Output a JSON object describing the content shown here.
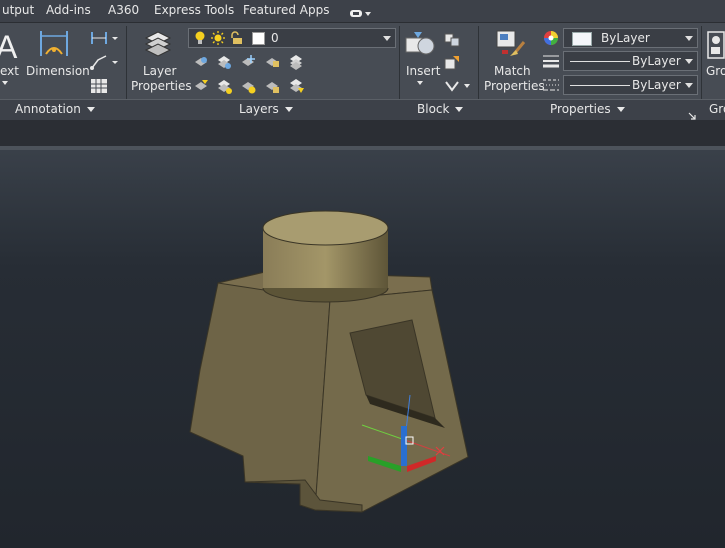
{
  "menu": {
    "items": [
      "utput",
      "Add-ins",
      "A360",
      "Express Tools",
      "Featured Apps"
    ]
  },
  "annotation_panel": {
    "text_label": "ext",
    "dimension_label": "Dimension",
    "panel_label": "Annotation"
  },
  "layers_panel": {
    "layer_properties_label_1": "Layer",
    "layer_properties_label_2": "Properties",
    "current_layer": "0",
    "panel_label": "Layers"
  },
  "block_panel": {
    "insert_label": "Insert",
    "panel_label": "Block"
  },
  "properties_panel": {
    "match_label_1": "Match",
    "match_label_2": "Properties",
    "color_value": "ByLayer",
    "linetype_value": "ByLayer",
    "lineweight_value": "ByLayer",
    "panel_label": "Properties"
  },
  "groups_panel": {
    "group_label": "Gro",
    "panel_label": "Gro"
  },
  "colors": {
    "menubar": "#3d4149",
    "ribbon": "#474c54",
    "viewport": "#272d35",
    "model": "#6f6448",
    "ucs_x": "#e02828",
    "ucs_y": "#28b028",
    "ucs_z": "#2a7be0"
  },
  "icons": [
    "drawing-tray-icon",
    "layer-stack-icon",
    "lightbulb-icon",
    "sun-icon",
    "lock-icon",
    "insert-block-icon",
    "match-properties-icon",
    "color-wheel-icon",
    "group-icon"
  ]
}
